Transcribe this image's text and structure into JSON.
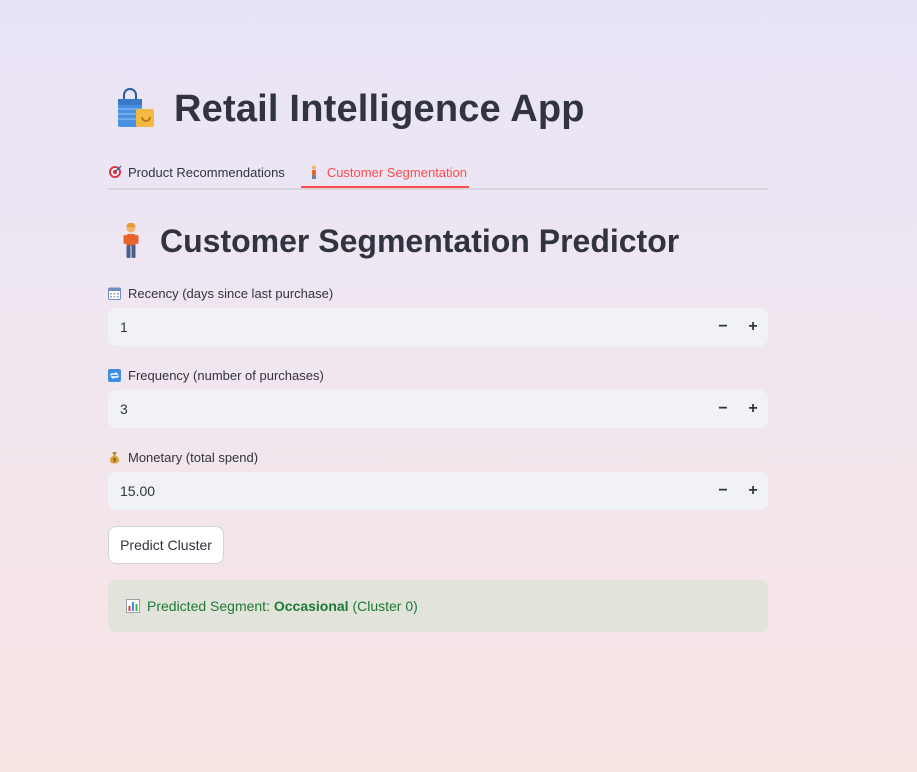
{
  "app": {
    "title": "Retail Intelligence App",
    "title_icon": "shopping-bags-icon"
  },
  "tabs": [
    {
      "label": "Product Recommendations",
      "icon": "target-icon",
      "active": false
    },
    {
      "label": "Customer Segmentation",
      "icon": "person-icon",
      "active": true
    }
  ],
  "section": {
    "title": "Customer Segmentation Predictor",
    "icon": "person-standing-icon"
  },
  "fields": [
    {
      "label": "Recency (days since last purchase)",
      "icon": "calendar-icon",
      "value": "1"
    },
    {
      "label": "Frequency (number of purchases)",
      "icon": "repeat-icon",
      "value": "3"
    },
    {
      "label": "Monetary (total spend)",
      "icon": "money-bag-icon",
      "value": "15.00"
    }
  ],
  "stepper": {
    "minus": "−",
    "plus": "+"
  },
  "predict_button": "Predict Cluster",
  "result": {
    "icon": "bar-chart-icon",
    "prefix": "Predicted Segment: ",
    "segment": "Occasional",
    "suffix": " (Cluster 0)"
  },
  "colors": {
    "accent": "#ff4b4b",
    "success_text": "#1e7a36",
    "success_bg": "#e2e3db",
    "input_bg": "#f0f2f6"
  }
}
